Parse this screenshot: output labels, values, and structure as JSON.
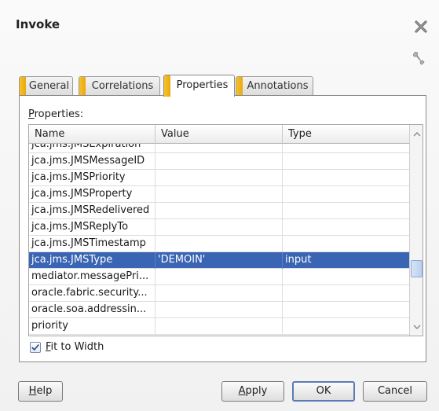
{
  "dialog": {
    "title": "Invoke"
  },
  "tabs": [
    {
      "label": "General",
      "active": false
    },
    {
      "label": "Correlations",
      "active": false
    },
    {
      "label": "Properties",
      "active": true
    },
    {
      "label": "Annotations",
      "active": false
    }
  ],
  "properties": {
    "label_prefix": "P",
    "label_rest": "roperties:",
    "columns": [
      "Name",
      "Value",
      "Type"
    ],
    "rows": [
      {
        "name": "jca.jms.JMSExpiration",
        "value": "",
        "type": ""
      },
      {
        "name": "jca.jms.JMSMessageID",
        "value": "",
        "type": ""
      },
      {
        "name": "jca.jms.JMSPriority",
        "value": "",
        "type": ""
      },
      {
        "name": "jca.jms.JMSProperty",
        "value": "",
        "type": ""
      },
      {
        "name": "jca.jms.JMSRedelivered",
        "value": "",
        "type": ""
      },
      {
        "name": "jca.jms.JMSReplyTo",
        "value": "",
        "type": ""
      },
      {
        "name": "jca.jms.JMSTimestamp",
        "value": "",
        "type": ""
      },
      {
        "name": "jca.jms.JMSType",
        "value": "'DEMOIN'",
        "type": "input",
        "selected": true
      },
      {
        "name": "mediator.messagePri...",
        "value": "",
        "type": ""
      },
      {
        "name": "oracle.fabric.security...",
        "value": "",
        "type": ""
      },
      {
        "name": "oracle.soa.addressin...",
        "value": "",
        "type": ""
      },
      {
        "name": "priority",
        "value": "",
        "type": ""
      }
    ]
  },
  "fit_to_width": {
    "checked": true,
    "label_prefix": "F",
    "label_rest": "it to Width"
  },
  "buttons": {
    "help_prefix": "H",
    "help_rest": "elp",
    "apply_prefix": "A",
    "apply_rest": "pply",
    "ok": "OK",
    "cancel": "Cancel"
  },
  "colors": {
    "selection": "#3a64b4",
    "tab_accent": "#f8c12a"
  },
  "icons": [
    "close-icon",
    "wrench-icon",
    "checkmark-icon",
    "scroll-up-icon",
    "scroll-down-icon"
  ]
}
